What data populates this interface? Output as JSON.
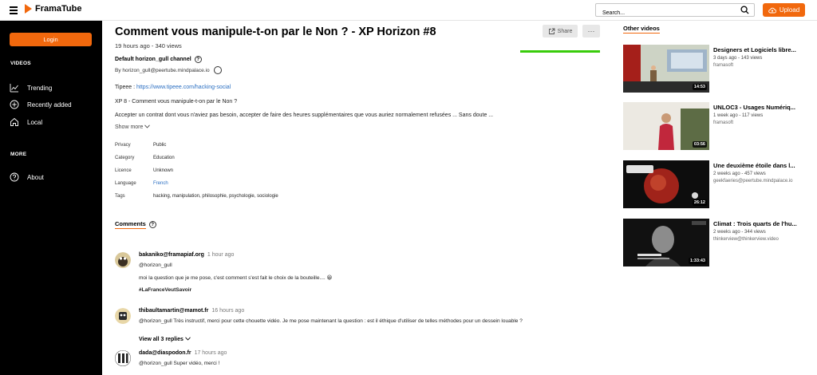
{
  "header": {
    "app_name": "FramaTube",
    "search_placeholder": "Search...",
    "upload_label": "Upload"
  },
  "sidebar": {
    "login_label": "Login",
    "videos_heading": "VIDEOS",
    "items": [
      {
        "label": "Trending",
        "icon": "trending-icon"
      },
      {
        "label": "Recently added",
        "icon": "plus-circle-icon"
      },
      {
        "label": "Local",
        "icon": "home-icon"
      }
    ],
    "more_heading": "MORE",
    "about_label": "About"
  },
  "video": {
    "title": "Comment vous manipule-t-on par le Non ? - XP Horizon #8",
    "meta": "19 hours ago - 340 views",
    "share_label": "Share",
    "more_label": "···",
    "channel": "Default horizon_gull channel",
    "by": "By horizon_gull@peertube.mindpalace.io",
    "tipeee_prefix": "Tipeee : ",
    "tipeee_link": "https://www.tipeee.com/hacking-social",
    "desc_line1": "XP 8 - Comment vous manipule-t-on par le Non ?",
    "desc_line2": "Accepter un contrat dont vous n'aviez pas besoin, accepter de faire des heures supplémentaires que vous auriez normalement refusées ... Sans doute ...",
    "show_more": "Show more",
    "like_ratio": 1.0,
    "attributes": [
      {
        "label": "Privacy",
        "value": "Public"
      },
      {
        "label": "Category",
        "value": "Education"
      },
      {
        "label": "Licence",
        "value": "Unknown"
      },
      {
        "label": "Language",
        "value": "French"
      },
      {
        "label": "Tags",
        "value": "hacking, manipulation, philosophie, psychologie, sociologie"
      }
    ]
  },
  "comments": {
    "heading": "Comments",
    "items": [
      {
        "author": "bakaniko@framapiaf.org",
        "time": "1 hour ago",
        "lines": [
          "@horizon_gull",
          "moi la question que je me pose, c'est comment s'est fait le choix de la bouteille.... 😀",
          "#LaFranceVeutSavoir"
        ]
      },
      {
        "author": "thibaultamartin@mamot.fr",
        "time": "16 hours ago",
        "lines": [
          "@horizon_gull Très instructif, merci pour cette chouette vidéo. Je me pose maintenant la question : est il éthique d'utiliser de telles méthodes pour un dessein louable ?"
        ],
        "replies": "View all 3 replies"
      },
      {
        "author": "dada@diaspodon.fr",
        "time": "17 hours ago",
        "lines": [
          "@horizon_gull Super vidéo, merci !"
        ]
      }
    ]
  },
  "other_videos": {
    "heading": "Other videos",
    "items": [
      {
        "title": "Designers et Logiciels libre...",
        "meta": "3 days ago - 143 views",
        "account": "framasoft",
        "duration": "14:53"
      },
      {
        "title": "UNLOC3 - Usages Numériq...",
        "meta": "1 week ago - 117 views",
        "account": "framasoft",
        "duration": "03:56"
      },
      {
        "title": "Une deuxième étoile dans l...",
        "meta": "2 weeks ago - 457 views",
        "account": "geekfaeries@peertube.mindpalace.io",
        "duration": "26:12"
      },
      {
        "title": "Climat : Trois quarts de l'hu...",
        "meta": "2 weeks ago - 344 views",
        "account": "thinkerview@thinkerview.video",
        "duration": "1:33:43"
      }
    ]
  },
  "colors": {
    "accent": "#f1680d",
    "like": "#39cc0b",
    "link": "#2b6fc2"
  }
}
